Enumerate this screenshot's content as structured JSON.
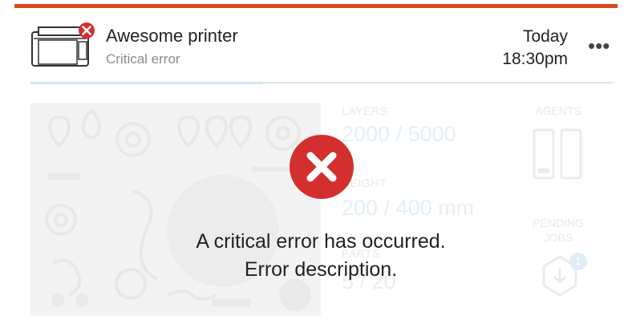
{
  "header": {
    "device_name": "Awesome printer",
    "status": "Critical error",
    "date": "Today",
    "time": "18:30pm",
    "more_label": "•••"
  },
  "stats": {
    "layers_label": "LAYERS",
    "layers_value": "2000 / 5000",
    "height_label": "HEIGHT",
    "height_value": "200 / 400 mm",
    "parts_label": "PARTS",
    "parts_value": "5 / 20",
    "agents_label": "AGENTS",
    "pending_label": "PENDING",
    "jobs_label": "JOBS",
    "pending_count": "1"
  },
  "error": {
    "line1": "A critical error has occurred.",
    "line2": "Error description."
  },
  "colors": {
    "accent": "#d94a1e",
    "error": "#d32f2f",
    "progress": "#cfe9f4"
  },
  "icons": {
    "printer": "printer-icon",
    "status_badge": "error-badge-icon",
    "error": "error-x-icon",
    "download": "download-shield-icon"
  }
}
